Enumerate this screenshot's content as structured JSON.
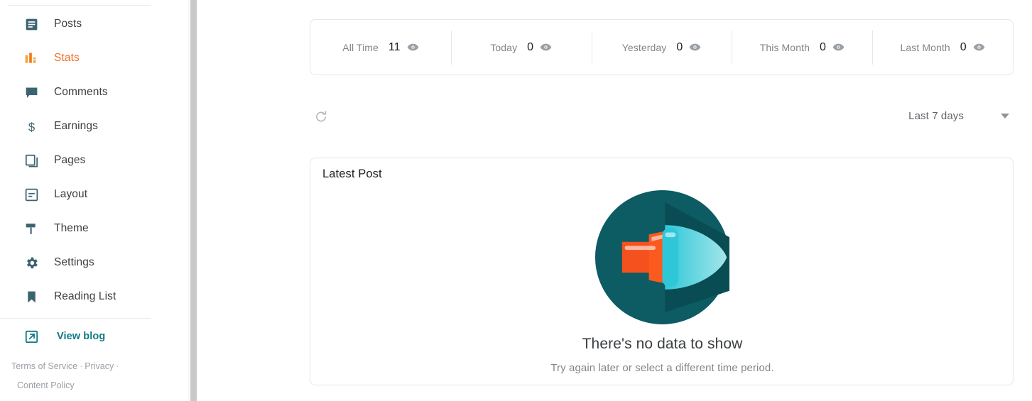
{
  "sidebar": {
    "items": [
      {
        "label": "Posts",
        "icon": "posts-icon",
        "active": false
      },
      {
        "label": "Stats",
        "icon": "stats-icon",
        "active": true
      },
      {
        "label": "Comments",
        "icon": "comments-icon",
        "active": false
      },
      {
        "label": "Earnings",
        "icon": "earnings-icon",
        "active": false
      },
      {
        "label": "Pages",
        "icon": "pages-icon",
        "active": false
      },
      {
        "label": "Layout",
        "icon": "layout-icon",
        "active": false
      },
      {
        "label": "Theme",
        "icon": "theme-icon",
        "active": false
      },
      {
        "label": "Settings",
        "icon": "settings-icon",
        "active": false
      },
      {
        "label": "Reading List",
        "icon": "reading-list-icon",
        "active": false
      }
    ],
    "view_blog": {
      "label": "View blog",
      "icon": "open-in-new-icon"
    },
    "footer": {
      "terms": "Terms of Service",
      "sep1": "·",
      "privacy": "Privacy",
      "sep2": "·",
      "content_policy": "Content Policy"
    }
  },
  "stats": {
    "items": [
      {
        "label": "All Time",
        "value": "11",
        "icon": "eye-icon"
      },
      {
        "label": "Today",
        "value": "0",
        "icon": "eye-icon"
      },
      {
        "label": "Yesterday",
        "value": "0",
        "icon": "eye-icon"
      },
      {
        "label": "This Month",
        "value": "0",
        "icon": "eye-icon"
      },
      {
        "label": "Last Month",
        "value": "0",
        "icon": "eye-icon"
      }
    ]
  },
  "toolbar": {
    "refresh_icon": "refresh-icon",
    "range_value": "Last 7 days",
    "caret_icon": "chevron-down-icon"
  },
  "post_card": {
    "title": "Latest Post",
    "empty_illustration": "flashlight-beam-illustration",
    "empty_heading": "There's no data to show",
    "empty_subtext": "Try again later or select a different time period."
  },
  "colors": {
    "accent_orange": "#ef7120",
    "icon_teal": "#3c6470",
    "link_teal": "#0f7b85",
    "illus_dark_teal": "#0d5b63",
    "illus_light_teal": "#3fd0de",
    "illus_orange": "#f4511e"
  }
}
